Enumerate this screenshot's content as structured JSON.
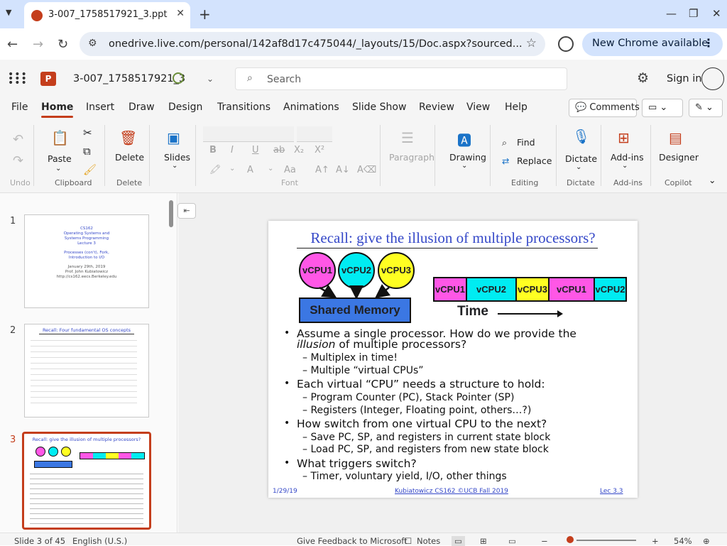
{
  "browser": {
    "tab_title": "3-007_1758517921_3.ppt",
    "url": "onedrive.live.com/personal/142af8d17c475044/_layouts/15/Doc.aspx?sourced...",
    "new_chrome_label": "New Chrome available"
  },
  "app": {
    "doc_title": "3-007_1758517921_3",
    "search_placeholder": "Search",
    "sign_in": "Sign in"
  },
  "menu": {
    "items": [
      "File",
      "Home",
      "Insert",
      "Draw",
      "Design",
      "Transitions",
      "Animations",
      "Slide Show",
      "Review",
      "View",
      "Help"
    ],
    "comments_label": "Comments"
  },
  "ribbon": {
    "undo": "Undo",
    "paste": "Paste",
    "clipboard": "Clipboard",
    "delete": "Delete",
    "delete_group": "Delete",
    "slides": "Slides",
    "font_group": "Font",
    "paragraph": "Paragraph",
    "drawing": "Drawing",
    "find": "Find",
    "replace": "Replace",
    "editing": "Editing",
    "dictate": "Dictate",
    "dictate_group": "Dictate",
    "addins": "Add-ins",
    "addins_group": "Add-ins",
    "designer": "Designer",
    "copilot": "Copilot",
    "accent_color": "#c43e1c"
  },
  "thumbnails": [
    {
      "num": "1",
      "lines": [
        "CS162",
        "Operating Systems and",
        "Systems Programming",
        "Lecture 3",
        "Processes (con't), Fork,",
        "Introduction to I/O",
        "January 29th, 2019",
        "Prof. John Kubiatowicz",
        "http://cs162.eecs.Berkeley.edu"
      ]
    },
    {
      "num": "2",
      "title": "Recall: Four fundamental OS concepts"
    },
    {
      "num": "3",
      "title": "Recall: give the illusion of multiple processors?"
    }
  ],
  "slide": {
    "title": "Recall: give the illusion of multiple processors?",
    "vcpus": [
      {
        "label": "vCPU1",
        "color": "#ff57e6"
      },
      {
        "label": "vCPU2",
        "color": "#00ecf2"
      },
      {
        "label": "vCPU3",
        "color": "#ffff22"
      }
    ],
    "shared_memory": "Shared Memory",
    "timeline": [
      {
        "label": "vCPU1",
        "color": "#ff57e6"
      },
      {
        "label": "vCPU2",
        "color": "#00ecf2"
      },
      {
        "label": "vCPU3",
        "color": "#ffff22"
      },
      {
        "label": "vCPU1",
        "color": "#ff57e6"
      },
      {
        "label": "vCPU2",
        "color": "#00ecf2"
      }
    ],
    "time_label": "Time",
    "bullets": {
      "b1_line1": "Assume a single processor.  How do we provide the",
      "b1_line2a": "illusion",
      "b1_line2b": " of multiple processors?",
      "b1_s1": "– Multiplex in time!",
      "b1_s2": "– Multiple “virtual CPUs”",
      "b2": "Each virtual “CPU” needs a structure to hold:",
      "b2_s1": "– Program Counter (PC), Stack Pointer (SP)",
      "b2_s2": "– Registers (Integer, Floating point, others…?)",
      "b3": "How switch from one virtual CPU to the next?",
      "b3_s1": "– Save PC, SP, and registers in current state block",
      "b3_s2": "– Load PC, SP, and registers from new state block",
      "b4": "What triggers switch?",
      "b4_s1": "– Timer, voluntary yield, I/O, other things"
    },
    "footer_left": "1/29/19",
    "footer_center": "Kubiatowicz CS162 ©UCB Fall 2019",
    "footer_right": "Lec 3.3"
  },
  "status": {
    "slide_of": "Slide 3 of 45",
    "language": "English (U.S.)",
    "feedback": "Give Feedback to Microsoft",
    "notes": "Notes",
    "zoom": "54%"
  }
}
